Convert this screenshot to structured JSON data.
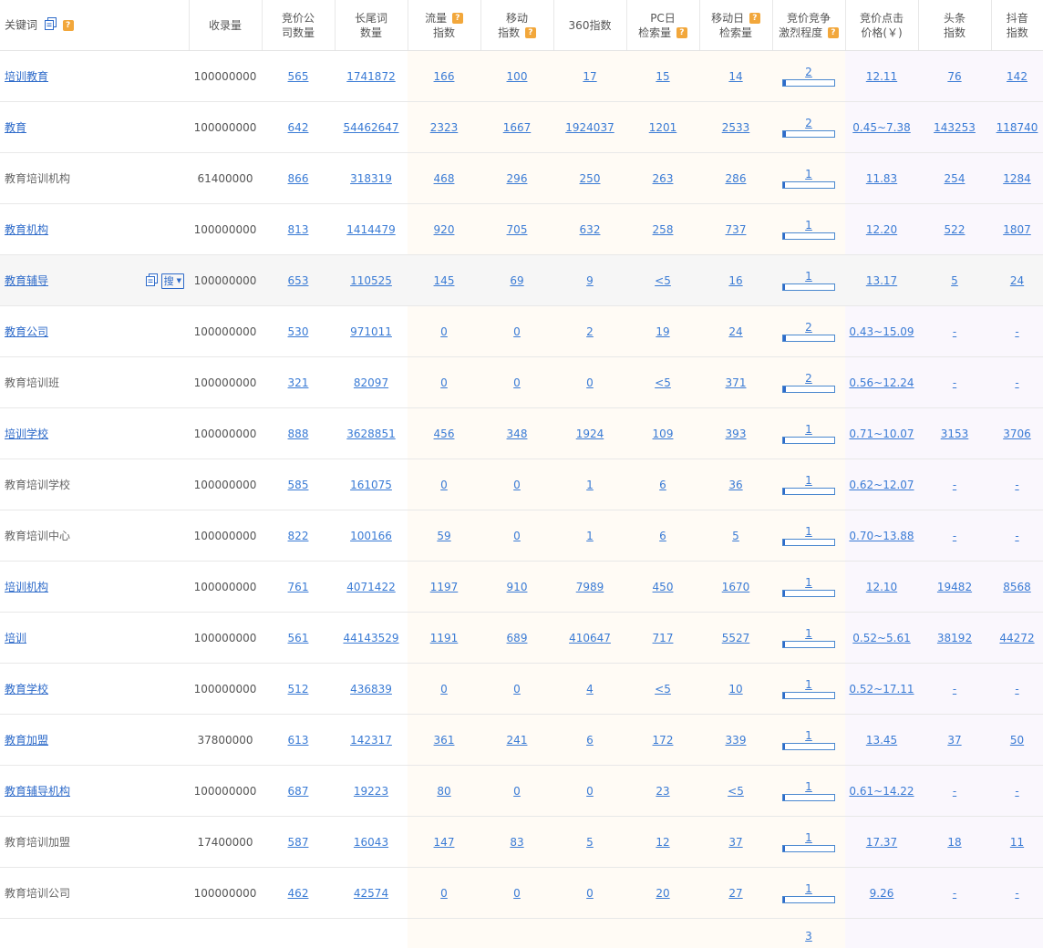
{
  "headers": {
    "keyword": "关键词",
    "indexed": "收录量",
    "bid_companies": [
      "竞价公",
      "司数量"
    ],
    "longtail": [
      "长尾词",
      "数量"
    ],
    "traffic": [
      "流量",
      "指数"
    ],
    "mobile": [
      "移动",
      "指数"
    ],
    "idx360": "360指数",
    "pc_daily": [
      "PC日",
      "检索量"
    ],
    "mobile_daily": [
      "移动日",
      "检索量"
    ],
    "competition": [
      "竞价竞争",
      "激烈程度"
    ],
    "bid_price": [
      "竞价点击",
      "价格(￥)"
    ],
    "toutiao": [
      "头条",
      "指数"
    ],
    "douyin": [
      "抖音",
      "指数"
    ]
  },
  "help_mark": "?",
  "search_button_label": "搜",
  "rows": [
    {
      "keyword": "培训教育",
      "linked": true,
      "indexed": "100000000",
      "bid_companies": "565",
      "longtail": "1741872",
      "traffic": "166",
      "mobile": "100",
      "idx360": "17",
      "pc_daily": "15",
      "mobile_daily": "14",
      "competition": "2",
      "bid_price": "12.11",
      "toutiao": "76",
      "douyin": "142"
    },
    {
      "keyword": "教育",
      "linked": true,
      "indexed": "100000000",
      "bid_companies": "642",
      "longtail": "54462647",
      "traffic": "2323",
      "mobile": "1667",
      "idx360": "1924037",
      "pc_daily": "1201",
      "mobile_daily": "2533",
      "competition": "2",
      "bid_price": "0.45~7.38",
      "toutiao": "143253",
      "douyin": "118740"
    },
    {
      "keyword": "教育培训机构",
      "linked": false,
      "indexed": "61400000",
      "bid_companies": "866",
      "longtail": "318319",
      "traffic": "468",
      "mobile": "296",
      "idx360": "250",
      "pc_daily": "263",
      "mobile_daily": "286",
      "competition": "1",
      "bid_price": "11.83",
      "toutiao": "254",
      "douyin": "1284"
    },
    {
      "keyword": "教育机构",
      "linked": true,
      "indexed": "100000000",
      "bid_companies": "813",
      "longtail": "1414479",
      "traffic": "920",
      "mobile": "705",
      "idx360": "632",
      "pc_daily": "258",
      "mobile_daily": "737",
      "competition": "1",
      "bid_price": "12.20",
      "toutiao": "522",
      "douyin": "1807"
    },
    {
      "keyword": "教育辅导",
      "linked": true,
      "hover": true,
      "indexed": "100000000",
      "bid_companies": "653",
      "longtail": "110525",
      "traffic": "145",
      "mobile": "69",
      "idx360": "9",
      "pc_daily": "<5",
      "mobile_daily": "16",
      "competition": "1",
      "bid_price": "13.17",
      "toutiao": "5",
      "douyin": "24"
    },
    {
      "keyword": "教育公司",
      "linked": true,
      "indexed": "100000000",
      "bid_companies": "530",
      "longtail": "971011",
      "traffic": "0",
      "mobile": "0",
      "idx360": "2",
      "pc_daily": "19",
      "mobile_daily": "24",
      "competition": "2",
      "bid_price": "0.43~15.09",
      "toutiao": "-",
      "douyin": "-"
    },
    {
      "keyword": "教育培训班",
      "linked": false,
      "indexed": "100000000",
      "bid_companies": "321",
      "longtail": "82097",
      "traffic": "0",
      "mobile": "0",
      "idx360": "0",
      "pc_daily": "<5",
      "mobile_daily": "371",
      "competition": "2",
      "bid_price": "0.56~12.24",
      "toutiao": "-",
      "douyin": "-"
    },
    {
      "keyword": "培训学校",
      "linked": true,
      "indexed": "100000000",
      "bid_companies": "888",
      "longtail": "3628851",
      "traffic": "456",
      "mobile": "348",
      "idx360": "1924",
      "pc_daily": "109",
      "mobile_daily": "393",
      "competition": "1",
      "bid_price": "0.71~10.07",
      "toutiao": "3153",
      "douyin": "3706"
    },
    {
      "keyword": "教育培训学校",
      "linked": false,
      "indexed": "100000000",
      "bid_companies": "585",
      "longtail": "161075",
      "traffic": "0",
      "mobile": "0",
      "idx360": "1",
      "pc_daily": "6",
      "mobile_daily": "36",
      "competition": "1",
      "bid_price": "0.62~12.07",
      "toutiao": "-",
      "douyin": "-"
    },
    {
      "keyword": "教育培训中心",
      "linked": false,
      "indexed": "100000000",
      "bid_companies": "822",
      "longtail": "100166",
      "traffic": "59",
      "mobile": "0",
      "idx360": "1",
      "pc_daily": "6",
      "mobile_daily": "5",
      "competition": "1",
      "bid_price": "0.70~13.88",
      "toutiao": "-",
      "douyin": "-"
    },
    {
      "keyword": "培训机构",
      "linked": true,
      "indexed": "100000000",
      "bid_companies": "761",
      "longtail": "4071422",
      "traffic": "1197",
      "mobile": "910",
      "idx360": "7989",
      "pc_daily": "450",
      "mobile_daily": "1670",
      "competition": "1",
      "bid_price": "12.10",
      "toutiao": "19482",
      "douyin": "8568"
    },
    {
      "keyword": "培训",
      "linked": true,
      "indexed": "100000000",
      "bid_companies": "561",
      "longtail": "44143529",
      "traffic": "1191",
      "mobile": "689",
      "idx360": "410647",
      "pc_daily": "717",
      "mobile_daily": "5527",
      "competition": "1",
      "bid_price": "0.52~5.61",
      "toutiao": "38192",
      "douyin": "44272"
    },
    {
      "keyword": "教育学校",
      "linked": true,
      "indexed": "100000000",
      "bid_companies": "512",
      "longtail": "436839",
      "traffic": "0",
      "mobile": "0",
      "idx360": "4",
      "pc_daily": "<5",
      "mobile_daily": "10",
      "competition": "1",
      "bid_price": "0.52~17.11",
      "toutiao": "-",
      "douyin": "-"
    },
    {
      "keyword": "教育加盟",
      "linked": true,
      "indexed": "37800000",
      "bid_companies": "613",
      "longtail": "142317",
      "traffic": "361",
      "mobile": "241",
      "idx360": "6",
      "pc_daily": "172",
      "mobile_daily": "339",
      "competition": "1",
      "bid_price": "13.45",
      "toutiao": "37",
      "douyin": "50"
    },
    {
      "keyword": "教育辅导机构",
      "linked": true,
      "indexed": "100000000",
      "bid_companies": "687",
      "longtail": "19223",
      "traffic": "80",
      "mobile": "0",
      "idx360": "0",
      "pc_daily": "23",
      "mobile_daily": "<5",
      "competition": "1",
      "bid_price": "0.61~14.22",
      "toutiao": "-",
      "douyin": "-"
    },
    {
      "keyword": "教育培训加盟",
      "linked": false,
      "indexed": "17400000",
      "bid_companies": "587",
      "longtail": "16043",
      "traffic": "147",
      "mobile": "83",
      "idx360": "5",
      "pc_daily": "12",
      "mobile_daily": "37",
      "competition": "1",
      "bid_price": "17.37",
      "toutiao": "18",
      "douyin": "11"
    },
    {
      "keyword": "教育培训公司",
      "linked": false,
      "indexed": "100000000",
      "bid_companies": "462",
      "longtail": "42574",
      "traffic": "0",
      "mobile": "0",
      "idx360": "0",
      "pc_daily": "20",
      "mobile_daily": "27",
      "competition": "1",
      "bid_price": "9.26",
      "toutiao": "-",
      "douyin": "-"
    }
  ],
  "partial_row": {
    "competition": "3"
  },
  "colors": {
    "link": "#3a7bd5",
    "keyword_link": "#2d6ac9",
    "help_icon": "#f2a73b",
    "orange_bg": "#fffbf5",
    "purple_bg": "#faf7fd",
    "bar_fill": "#2d6ac9"
  }
}
